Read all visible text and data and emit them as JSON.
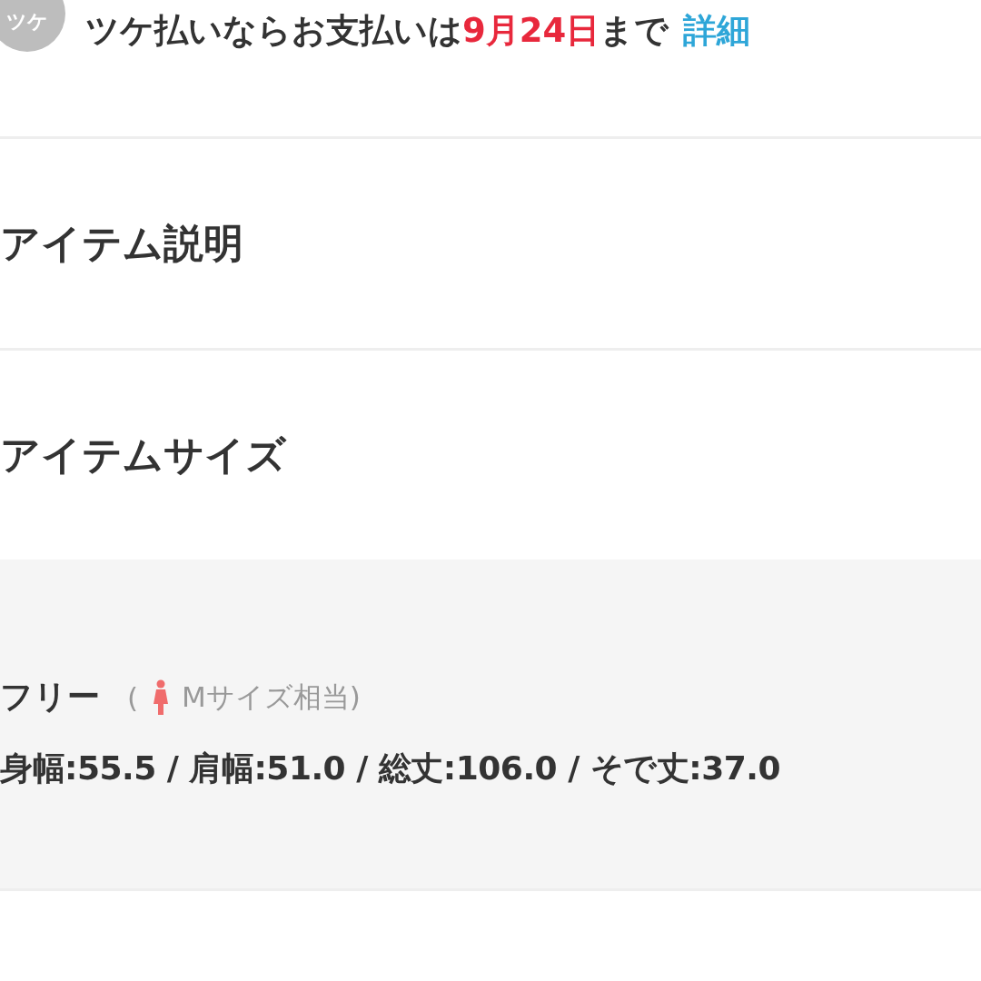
{
  "payment_notice": {
    "badge": "ツケ",
    "text_before": "ツケ払いならお支払いは",
    "due_date": "9月24日",
    "text_after": "まで",
    "link": "詳細"
  },
  "sections": [
    {
      "title": "アイテム説明"
    },
    {
      "title": "アイテムサイズ"
    }
  ],
  "size_info": {
    "size": "フリー",
    "equivalent_open": "(",
    "equivalent": "Mサイズ相当)",
    "measurements": "身幅:55.5 / 肩幅:51.0 / 総丈:106.0 / そで丈:37.0"
  }
}
